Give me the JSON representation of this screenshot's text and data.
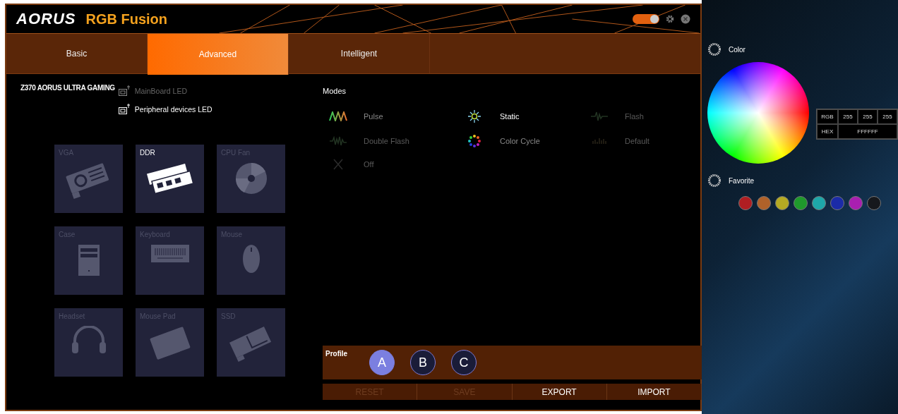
{
  "header": {
    "brand": "AORUS",
    "app_title": "RGB Fusion",
    "power_toggle": {
      "on": true
    }
  },
  "tabs": [
    {
      "label": "Basic",
      "selected": false
    },
    {
      "label": "Advanced",
      "selected": true
    },
    {
      "label": "Intelligent",
      "selected": false
    }
  ],
  "device_title": "Z370 AORUS ULTRA GAMING",
  "led_groups": [
    {
      "label": "MainBoard LED",
      "selected": false
    },
    {
      "label": "Peripheral devices LED",
      "selected": true
    }
  ],
  "devices": [
    {
      "label": "VGA",
      "kind": "vga",
      "selected": false
    },
    {
      "label": "DDR",
      "kind": "ddr",
      "selected": true
    },
    {
      "label": "CPU Fan",
      "kind": "fan",
      "selected": false
    },
    {
      "label": "Case",
      "kind": "case",
      "selected": false
    },
    {
      "label": "Keyboard",
      "kind": "keyboard",
      "selected": false
    },
    {
      "label": "Mouse",
      "kind": "mouse",
      "selected": false
    },
    {
      "label": "Headset",
      "kind": "headset",
      "selected": false
    },
    {
      "label": "Mouse Pad",
      "kind": "mousepad",
      "selected": false
    },
    {
      "label": "SSD",
      "kind": "ssd",
      "selected": false
    }
  ],
  "modes_title": "Modes",
  "modes": [
    {
      "label": "Pulse",
      "kind": "pulse",
      "selected": false,
      "disabled": false
    },
    {
      "label": "Static",
      "kind": "static",
      "selected": true,
      "disabled": false
    },
    {
      "label": "Flash",
      "kind": "flash",
      "selected": false,
      "disabled": true
    },
    {
      "label": "Double Flash",
      "kind": "doubleflash",
      "selected": false,
      "disabled": true
    },
    {
      "label": "Color Cycle",
      "kind": "cycle",
      "selected": false,
      "disabled": false
    },
    {
      "label": "Default",
      "kind": "default",
      "selected": false,
      "disabled": true
    },
    {
      "label": "Off",
      "kind": "off",
      "selected": false,
      "disabled": true
    }
  ],
  "profile": {
    "label": "Profile",
    "items": [
      {
        "label": "A",
        "selected": true
      },
      {
        "label": "B",
        "selected": false
      },
      {
        "label": "C",
        "selected": false
      }
    ]
  },
  "actions": [
    {
      "label": "RESET",
      "disabled": true
    },
    {
      "label": "SAVE",
      "disabled": true
    },
    {
      "label": "EXPORT",
      "disabled": false
    },
    {
      "label": "IMPORT",
      "disabled": false
    }
  ],
  "color_panel": {
    "color_title": "Color",
    "rgb_label": "RGB",
    "rgb_values": [
      "255",
      "255",
      "255"
    ],
    "hex_label": "HEX",
    "hex_value": "FFFFFF",
    "favorite_title": "Favorite",
    "favorites": [
      {
        "color": "#b01e22"
      },
      {
        "color": "#b0622a"
      },
      {
        "color": "#b5aa23"
      },
      {
        "color": "#1f9a2c"
      },
      {
        "color": "#1ea7a9"
      },
      {
        "color": "#1b2ba8"
      },
      {
        "color": "#a91fb0"
      },
      {
        "color": "#16181c"
      }
    ]
  }
}
